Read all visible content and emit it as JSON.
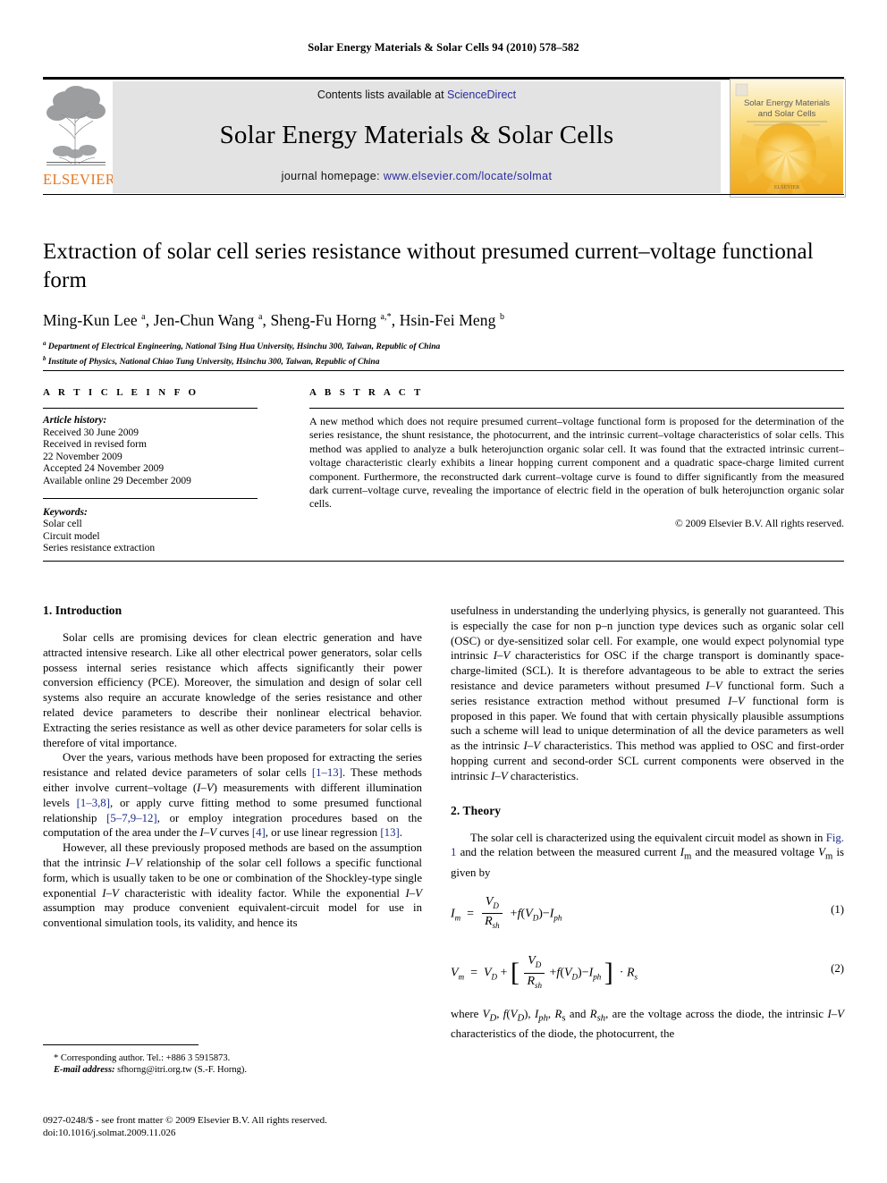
{
  "running_head": "Solar Energy Materials & Solar Cells 94 (2010) 578–582",
  "masthead": {
    "contents_prefix": "Contents lists available at ",
    "sciencedirect": "ScienceDirect",
    "journal_title": "Solar Energy Materials & Solar Cells",
    "homepage_prefix": "journal homepage: ",
    "homepage_url": "www.elsevier.com/locate/solmat",
    "publisher_wordmark": "ELSEVIER",
    "cover_title_line1": "Solar Energy Materials",
    "cover_title_line2": "and Solar Cells",
    "link_color": "#2b2b9e",
    "band_color": "#e3e3e3",
    "elsevier_orange": "#e87722"
  },
  "article": {
    "title": "Extraction of solar cell series resistance without presumed current–voltage functional form",
    "authors_html": "Ming-Kun Lee <sup>a</sup>, Jen-Chun Wang <sup>a</sup>, Sheng-Fu Horng <sup>a,</sup><sup>*</sup>, Hsin-Fei Meng <sup>b</sup>",
    "affiliation_a": "Department of Electrical Engineering, National Tsing Hua University, Hsinchu 300, Taiwan, Republic of China",
    "affiliation_b": "Institute of Physics, National Chiao Tung University, Hsinchu 300, Taiwan, Republic of China"
  },
  "info": {
    "heading": "A R T I C L E    I N F O",
    "history_label": "Article history:",
    "history": [
      "Received 30 June 2009",
      "Received in revised form",
      "22 November 2009",
      "Accepted 24 November 2009",
      "Available online 29 December 2009"
    ],
    "keywords_label": "Keywords:",
    "keywords": [
      "Solar cell",
      "Circuit model",
      "Series resistance extraction"
    ]
  },
  "abstract": {
    "heading": "A B S T R A C T",
    "text": "A new method which does not require presumed current–voltage functional form is proposed for the determination of the series resistance, the shunt resistance, the photocurrent, and the intrinsic current–voltage characteristics of solar cells. This method was applied to analyze a bulk heterojunction organic solar cell. It was found that the extracted intrinsic current–voltage characteristic clearly exhibits a linear hopping current component and a quadratic space-charge limited current component. Furthermore, the reconstructed dark current–voltage curve is found to differ significantly from the measured dark current–voltage curve, revealing the importance of electric field in the operation of bulk heterojunction organic solar cells.",
    "copyright": "© 2009 Elsevier B.V. All rights reserved."
  },
  "body": {
    "intro_heading": "1.  Introduction",
    "intro_p1": "Solar cells are promising devices for clean electric generation and have attracted intensive research. Like all other electrical power generators, solar cells possess internal series resistance which affects significantly their power conversion efficiency (PCE). Moreover, the simulation and design of solar cell systems also require an accurate knowledge of the series resistance and other related device parameters to describe their nonlinear electrical behavior. Extracting the series resistance as well as other device parameters for solar cells is therefore of vital importance.",
    "intro_p2_html": "Over the years, various methods have been proposed for extracting the series resistance and related device parameters of solar cells <span class=\"cite\">[1–13]</span>. These methods either involve current–voltage (<i>I</i>–<i>V</i>) measurements with different illumination levels <span class=\"cite\">[1–3,8]</span>, or apply curve fitting method to some presumed functional relationship <span class=\"cite\">[5–7,9–12]</span>, or employ integration procedures based on the computation of the area under the <i>I</i>–<i>V</i> curves <span class=\"cite\">[4]</span>, or use linear regression <span class=\"cite\">[13]</span>.",
    "intro_p3_html": "However, all these previously proposed methods are based on the assumption that the intrinsic <i>I</i>–<i>V</i> relationship of the solar cell follows a specific functional form, which is usually taken to be one or combination of the Shockley-type single exponential <i>I</i>–<i>V</i> characteristic with ideality factor. While the exponential <i>I</i>–<i>V</i> assumption may produce convenient equivalent-circuit model for use in conventional simulation tools, its validity, and hence its",
    "intro_p3_cont_html": "usefulness in understanding the underlying physics, is generally not guaranteed. This is especially the case for non p–n junction type devices such as organic solar cell (OSC) or dye-sensitized solar cell. For example, one would expect polynomial type intrinsic <i>I</i>–<i>V</i> characteristics for OSC if the charge transport is dominantly space-charge-limited (SCL). It is therefore advantageous to be able to extract the series resistance and device parameters without presumed <i>I</i>–<i>V</i> functional form. Such a series resistance extraction method without presumed <i>I</i>–<i>V</i> functional form is proposed in this paper. We found that with certain physically plausible assumptions such a scheme will lead to unique determination of all the device parameters as well as the intrinsic <i>I</i>–<i>V</i> characteristics. This method was applied to OSC and first-order hopping current and second-order SCL current components were observed in the intrinsic <i>I</i>–<i>V</i> characteristics.",
    "theory_heading": "2.  Theory",
    "theory_p1_html": "The solar cell is characterized using the equivalent circuit model as shown in <span class=\"cite\">Fig. 1</span> and the relation between the measured current <i>I</i><sub>m</sub> and the measured voltage <i>V</i><sub>m</sub> is given by",
    "eq1_number": "(1)",
    "eq2_number": "(2)",
    "theory_p2_html": "where <i>V<sub>D</sub></i>, <i>f</i>(<i>V<sub>D</sub></i>), <i>I<sub>ph</sub></i>, <i>R</i><sub>s</sub> and <i>R<sub>sh</sub></i>, are the voltage across the diode, the intrinsic <i>I</i>–<i>V</i> characteristics of the diode, the photocurrent, the"
  },
  "footnote": {
    "corresponding": "* Corresponding author. Tel.: +886 3 5915873.",
    "email_label": "E-mail address:",
    "email": "sfhorng@itri.org.tw (S.-F. Horng)."
  },
  "footer": {
    "issn_line": "0927-0248/$ - see front matter © 2009 Elsevier B.V. All rights reserved.",
    "doi_line": "doi:10.1016/j.solmat.2009.11.026"
  }
}
